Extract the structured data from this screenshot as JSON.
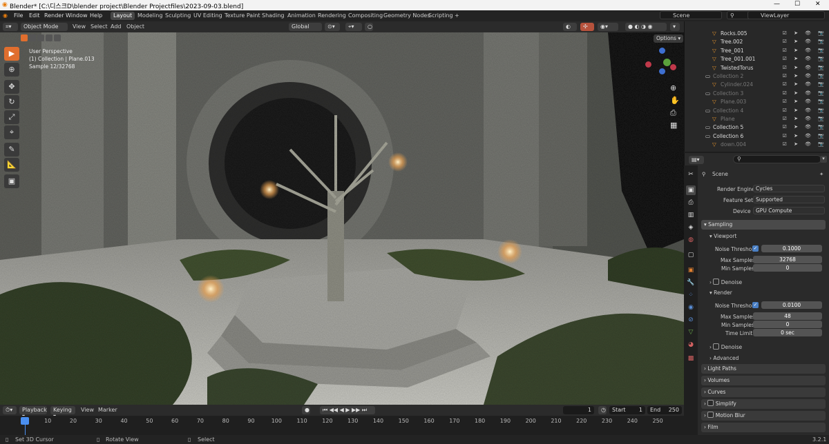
{
  "window": {
    "title": "Blender* [C:\\디스크D\\blender project\\Blender Projectfiles\\2023-09-03.blend]",
    "minimize": "—",
    "maximize": "☐",
    "close": "✕"
  },
  "menu": [
    "File",
    "Edit",
    "Render",
    "Window",
    "Help"
  ],
  "workspaces": [
    "Layout",
    "Modeling",
    "Sculpting",
    "UV Editing",
    "Texture Paint",
    "Shading",
    "Animation",
    "Rendering",
    "Compositing",
    "Geometry Nodes",
    "Scripting"
  ],
  "scene": "Scene",
  "view_layer": "ViewLayer",
  "viewport_header": {
    "mode": "Object Mode",
    "view": "View",
    "select": "Select",
    "add": "Add",
    "object": "Object",
    "orientation": "Global",
    "options": "Options"
  },
  "overlay_text": {
    "perspective": "User Perspective",
    "collection": "(1) Collection | Plane.013",
    "sample": "Sample 12/32768"
  },
  "timeline_header": {
    "playback": "Playback",
    "keying": "Keying",
    "view": "View",
    "marker": "Marker",
    "current_frame": "1",
    "start_label": "Start",
    "start": "1",
    "end_label": "End",
    "end": "250"
  },
  "ticks": [
    "1",
    "10",
    "20",
    "30",
    "40",
    "50",
    "60",
    "70",
    "80",
    "90",
    "100",
    "110",
    "120",
    "130",
    "140",
    "150",
    "160",
    "170",
    "180",
    "190",
    "200",
    "210",
    "220",
    "230",
    "240",
    "250"
  ],
  "status": {
    "set_cursor": "Set 3D Cursor",
    "rotate": "Rotate View",
    "select": "Select",
    "version": "3.2.1"
  },
  "outliner": [
    {
      "name": "Rocks.005",
      "dim": false
    },
    {
      "name": "Tree.002",
      "dim": false
    },
    {
      "name": "Tree_001",
      "dim": false
    },
    {
      "name": "Tree_001.001",
      "dim": false
    },
    {
      "name": "TwistedTorus",
      "dim": false
    },
    {
      "name": "Collection 2",
      "dim": true
    },
    {
      "name": "Cylinder.024",
      "dim": true
    },
    {
      "name": "Collection 3",
      "dim": true
    },
    {
      "name": "Plane.003",
      "dim": true
    },
    {
      "name": "Collection 4",
      "dim": true
    },
    {
      "name": "Plane",
      "dim": true
    },
    {
      "name": "Collection 5",
      "dim": false
    },
    {
      "name": "Collection 6",
      "dim": false
    },
    {
      "name": "down.004",
      "dim": true
    }
  ],
  "properties": {
    "scene_label": "Scene",
    "render_engine_label": "Render Engine",
    "render_engine": "Cycles",
    "feature_set_label": "Feature Set",
    "feature_set": "Supported",
    "device_label": "Device",
    "device": "GPU Compute",
    "sampling": "Sampling",
    "viewport": "Viewport",
    "noise_threshold_label": "Noise Threshold",
    "vp_noise": "0.1000",
    "max_samples_label": "Max Samples",
    "vp_max": "32768",
    "min_samples_label": "Min Samples",
    "vp_min": "0",
    "denoise": "Denoise",
    "render": "Render",
    "r_noise": "0.0100",
    "r_max": "48",
    "r_min": "0",
    "time_limit_label": "Time Limit",
    "r_time": "0 sec",
    "advanced": "Advanced",
    "light_paths": "Light Paths",
    "volumes": "Volumes",
    "curves": "Curves",
    "simplify": "Simplify",
    "motion_blur": "Motion Blur",
    "film": "Film"
  }
}
